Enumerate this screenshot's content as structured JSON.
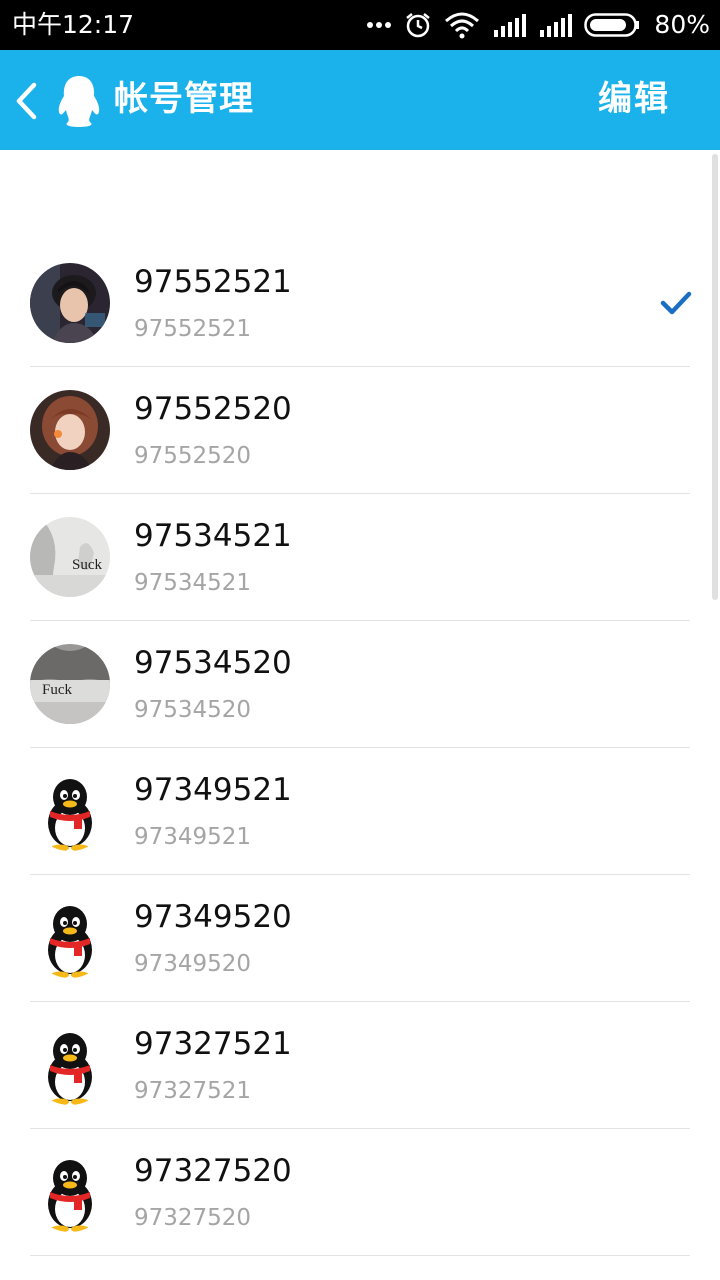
{
  "status_bar": {
    "time": "中午12:17",
    "battery": "80%",
    "icons": [
      "more-dots-icon",
      "alarm-icon",
      "wifi-icon",
      "signal-icon",
      "signal-icon",
      "battery-icon"
    ]
  },
  "header": {
    "title": "帐号管理",
    "edit_label": "编辑",
    "background": "#1bb2ec"
  },
  "accounts": [
    {
      "name": "97552521",
      "id": "97552521",
      "avatar": "photo-boy",
      "selected": true
    },
    {
      "name": "97552520",
      "id": "97552520",
      "avatar": "photo-girl",
      "selected": false
    },
    {
      "name": "97534521",
      "id": "97534521",
      "avatar": "photo-suck",
      "avatar_text": "Suck",
      "selected": false
    },
    {
      "name": "97534520",
      "id": "97534520",
      "avatar": "photo-fuck",
      "avatar_text": "Fuck",
      "selected": false
    },
    {
      "name": "97349521",
      "id": "97349521",
      "avatar": "qq-penguin-icon",
      "selected": false
    },
    {
      "name": "97349520",
      "id": "97349520",
      "avatar": "qq-penguin-icon",
      "selected": false
    },
    {
      "name": "97327521",
      "id": "97327521",
      "avatar": "qq-penguin-icon",
      "selected": false
    },
    {
      "name": "97327520",
      "id": "97327520",
      "avatar": "qq-penguin-icon",
      "selected": false
    }
  ],
  "colors": {
    "accent": "#1bb2ec",
    "check": "#1a6fc4",
    "secondary_text": "#a5a5a5"
  }
}
